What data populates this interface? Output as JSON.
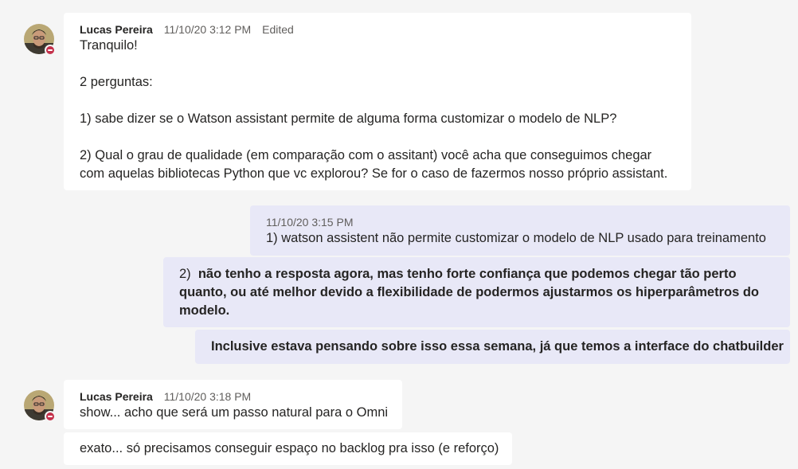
{
  "messages": [
    {
      "author": "Lucas Pereira",
      "time": "11/10/20 3:12 PM",
      "edited": "Edited",
      "lines": [
        "Tranquilo!",
        "2 perguntas:",
        "1) sabe dizer se o Watson assistant permite de alguma forma customizar o modelo de NLP?",
        "2) Qual o grau de qualidade (em comparação com o assitant) você acha que conseguimos chegar",
        "com aquelas bibliotecas Python  que vc explorou? Se for o caso de fazermos nosso próprio assistant."
      ]
    },
    {
      "time": "11/10/20 3:15 PM",
      "text": "1) watson assistent não permite customizar o modelo de NLP usado para treinamento"
    },
    {
      "prefix": "2)",
      "lines": [
        "não tenho a resposta agora, mas tenho forte confiança que podemos chegar tão perto",
        "quanto, ou até melhor devido a flexibilidade de podermos ajustarmos os hiperparâmetros do",
        "modelo."
      ]
    },
    {
      "text": "Inclusive estava pensando sobre isso essa semana, já que temos a interface do chatbuilder"
    },
    {
      "author": "Lucas Pereira",
      "time": "11/10/20 3:18 PM",
      "text": "show... acho que será um passo natural para o Omni"
    },
    {
      "text": "exato... só precisamos conseguir espaço no backlog pra isso (e reforço)"
    }
  ],
  "colors": {
    "background": "#f5f5f5",
    "other_bubble": "#ffffff",
    "my_bubble": "#e8e8f7",
    "presence_busy": "#c4314b"
  },
  "icons": {
    "avatar": "user-photo-avatar",
    "presence": "busy-presence-icon"
  }
}
